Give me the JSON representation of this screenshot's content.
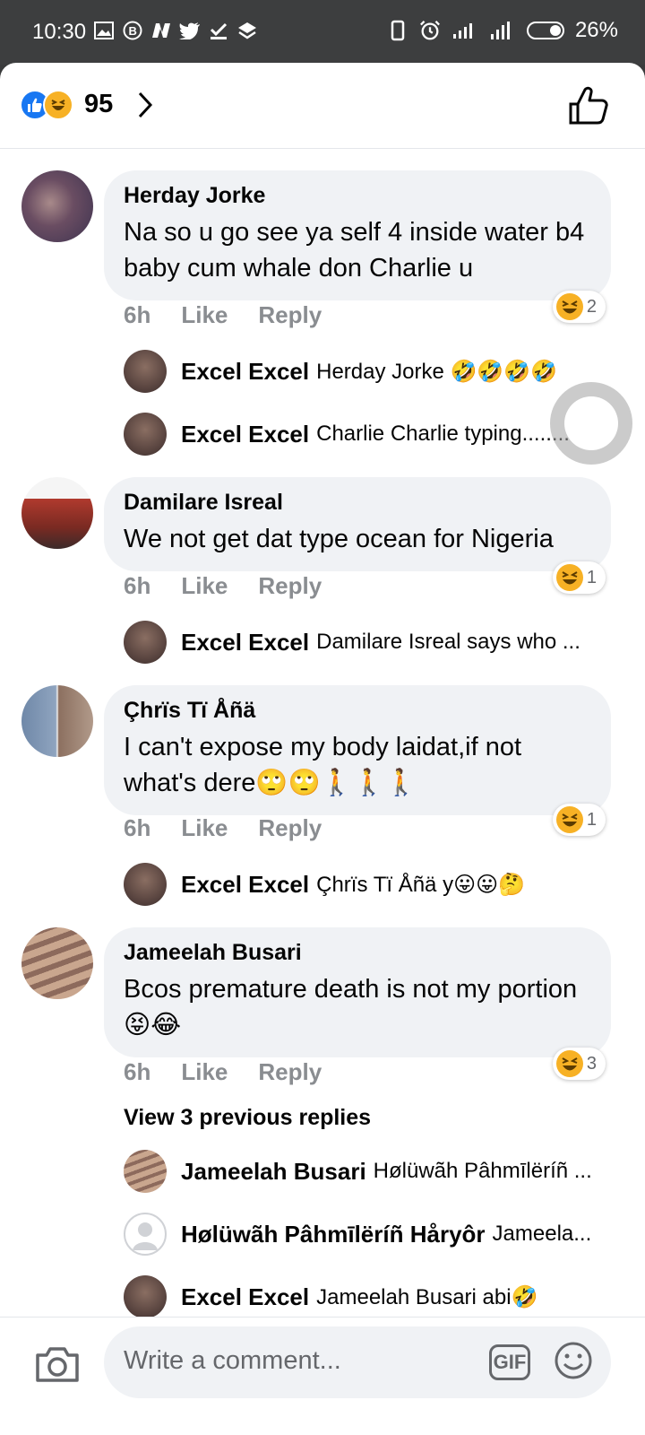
{
  "status": {
    "time": "10:30",
    "battery": "26%"
  },
  "header": {
    "reaction_count": "95"
  },
  "comments": [
    {
      "author": "Herday Jorke",
      "text": "Na so u go see ya self 4 inside water b4 baby cum whale don Charlie u",
      "time": "6h",
      "like": "Like",
      "reply": "Reply",
      "reaction_count": "2",
      "replies": [
        {
          "author": "Excel Excel",
          "text": "Herday Jorke 🤣🤣🤣🤣"
        },
        {
          "author": "Excel Excel",
          "text": "Charlie Charlie typing........."
        }
      ]
    },
    {
      "author": "Damilare Isreal",
      "text": "We not get dat type ocean for Nigeria",
      "time": "6h",
      "like": "Like",
      "reply": "Reply",
      "reaction_count": "1",
      "replies": [
        {
          "author": "Excel Excel",
          "text": "Damilare Isreal says who ..."
        }
      ]
    },
    {
      "author": "Çhrïs Tï Åñä",
      "text": "I can't expose my body laidat,if not what's dere🙄🙄🚶🚶🚶",
      "time": "6h",
      "like": "Like",
      "reply": "Reply",
      "reaction_count": "1",
      "replies": [
        {
          "author": "Excel Excel",
          "text": "Çhrïs Tï Åñä y😛😛🤔"
        }
      ]
    },
    {
      "author": "Jameelah Busari",
      "text": "Bcos premature death is not my portion 😝😂",
      "time": "6h",
      "like": "Like",
      "reply": "Reply",
      "reaction_count": "3",
      "view_previous": "View 3 previous replies",
      "replies": [
        {
          "author": "Jameelah Busari",
          "text": "Hølüwãh Pâhmīlëríñ ..."
        },
        {
          "author": "Hølüwãh Pâhmīlëríñ Håryôr",
          "text": "Jameela..."
        },
        {
          "author": "Excel Excel",
          "text": "Jameelah Busari abi🤣"
        }
      ]
    }
  ],
  "composer": {
    "placeholder": "Write a comment...",
    "gif_label": "GIF"
  },
  "colors": {
    "accent": "#1877f2",
    "haha": "#f7b125",
    "bubble": "#f0f2f5",
    "meta": "#8a8d91"
  },
  "icons": [
    "like-icon",
    "haha-icon",
    "chevron-right-icon",
    "thumbs-up-icon",
    "camera-icon",
    "gif-icon",
    "smiley-icon"
  ]
}
